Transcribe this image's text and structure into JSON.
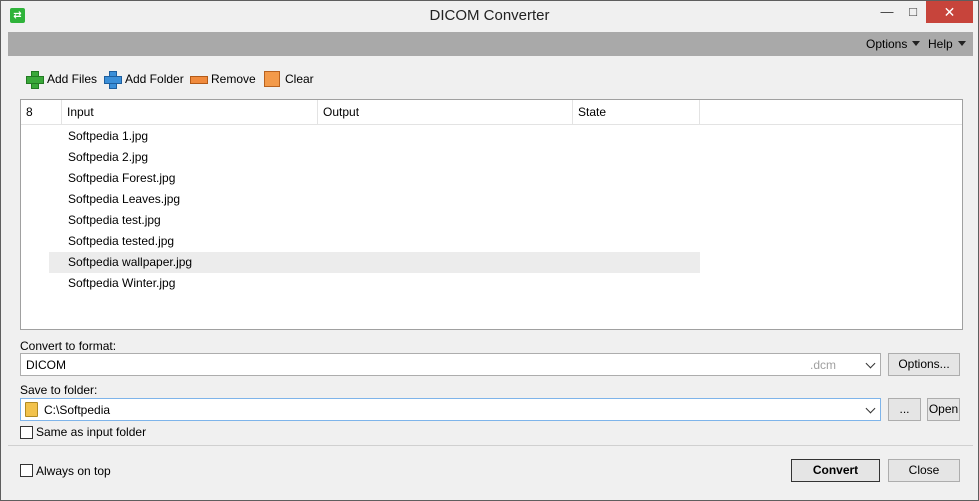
{
  "window": {
    "title": "DICOM Converter",
    "minimize_glyph": "—",
    "maximize_glyph": "□",
    "close_glyph": "✕"
  },
  "menu": {
    "options_label": "Options",
    "help_label": "Help"
  },
  "toolbar": {
    "add_files_label": "Add Files",
    "add_folder_label": "Add Folder",
    "remove_label": "Remove",
    "clear_label": "Clear"
  },
  "file_list": {
    "count": "8",
    "columns": [
      "Input",
      "Output",
      "State"
    ],
    "rows": [
      {
        "input": "Softpedia 1.jpg",
        "output": "",
        "state": ""
      },
      {
        "input": "Softpedia 2.jpg",
        "output": "",
        "state": ""
      },
      {
        "input": "Softpedia Forest.jpg",
        "output": "",
        "state": ""
      },
      {
        "input": "Softpedia Leaves.jpg",
        "output": "",
        "state": ""
      },
      {
        "input": "Softpedia test.jpg",
        "output": "",
        "state": ""
      },
      {
        "input": "Softpedia tested.jpg",
        "output": "",
        "state": ""
      },
      {
        "input": "Softpedia wallpaper.jpg",
        "output": "",
        "state": ""
      },
      {
        "input": "Softpedia Winter.jpg",
        "output": "",
        "state": ""
      }
    ],
    "selected_index": 6
  },
  "convert": {
    "format_label": "Convert to format:",
    "format_value": "DICOM",
    "format_ext": ".dcm",
    "options_button": "Options..."
  },
  "save": {
    "folder_label": "Save to folder:",
    "folder_value": "C:\\Softpedia",
    "browse_button": "...",
    "open_button": "Open",
    "same_as_input_label": "Same as input folder",
    "same_as_input_checked": false
  },
  "footer": {
    "always_on_top_label": "Always on top",
    "always_on_top_checked": false,
    "convert_button": "Convert",
    "close_button": "Close"
  },
  "icons": {
    "app": "convert-arrows-icon",
    "add_files": "green-plus-icon",
    "add_folder": "blue-plus-icon",
    "remove": "orange-minus-icon",
    "clear": "orange-square-icon",
    "folder": "folder-icon"
  },
  "colors": {
    "menubar_bg": "#a9a9a9",
    "close_button_bg": "#c7443b",
    "selected_row_bg": "#ececec",
    "folder_combo_border": "#7eb4ea"
  }
}
